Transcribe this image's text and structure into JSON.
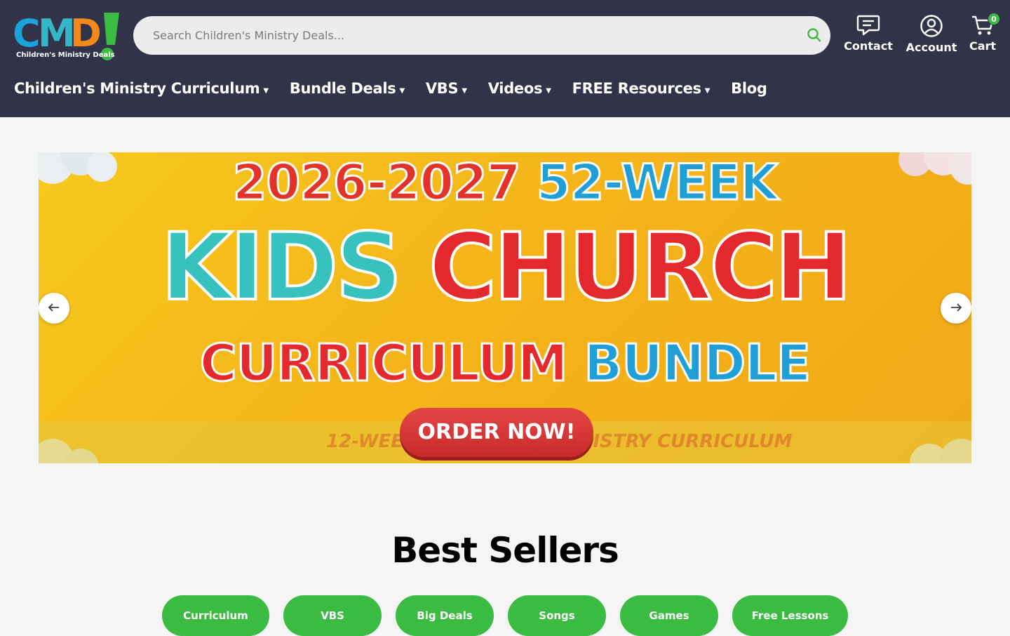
{
  "brand": {
    "logo_text": "CMD!",
    "tagline": "Children's Ministry Deals"
  },
  "search": {
    "placeholder": "Search Children's Ministry Deals...",
    "icon": "search-icon"
  },
  "header_actions": {
    "contact": {
      "label": "Contact",
      "icon": "chat-icon"
    },
    "account": {
      "label": "Account",
      "icon": "user-circle-icon"
    },
    "cart": {
      "label": "Cart",
      "icon": "cart-icon",
      "count": "0"
    }
  },
  "nav": {
    "items": [
      {
        "label": "Children's Ministry Curriculum",
        "dropdown": true
      },
      {
        "label": "Bundle Deals",
        "dropdown": true
      },
      {
        "label": "VBS",
        "dropdown": true
      },
      {
        "label": "Videos",
        "dropdown": true
      },
      {
        "label": "FREE Resources",
        "dropdown": true
      },
      {
        "label": "Blog",
        "dropdown": false
      }
    ]
  },
  "banner": {
    "line1_a": "2026-2027",
    "line1_b": "52-WEEK",
    "line2_a": "KIDS",
    "line2_b": "CHURCH",
    "line3_a": "CURRICULUM",
    "line3_b": "BUNDLE",
    "cta": "ORDER NOW!",
    "strip_text": "12-WEEK CHILDREN'S MINISTRY CURRICULUM"
  },
  "colors": {
    "header_bg": "#323349",
    "accent_green": "#3cbb42",
    "page_bg": "#f5f5f6"
  },
  "best_sellers": {
    "title": "Best Sellers",
    "categories": [
      "Curriculum",
      "VBS",
      "Big Deals",
      "Songs",
      "Games",
      "Free Lessons"
    ]
  }
}
